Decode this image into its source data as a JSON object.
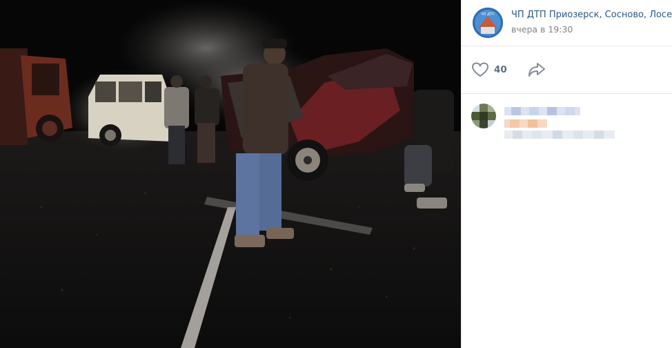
{
  "post": {
    "group_name": "ЧП ДТП Приозерск, Сосново, Лосе",
    "time": "вчера в 19:30",
    "avatar_icon": "group-logo-icon"
  },
  "actions": {
    "like_count": "40",
    "like_icon": "heart-icon",
    "share_icon": "share-arrow-icon"
  },
  "comment": {
    "author_avatar_icon": "pixelated-avatar-icon",
    "text_state": "pixelated"
  },
  "colors": {
    "link": "#2a5885",
    "meta": "#828282",
    "icon": "#828a99",
    "divider": "#e7e8ec",
    "pixel_blue": "#c8d4ea",
    "pixel_orange": "#f4c7a6"
  }
}
